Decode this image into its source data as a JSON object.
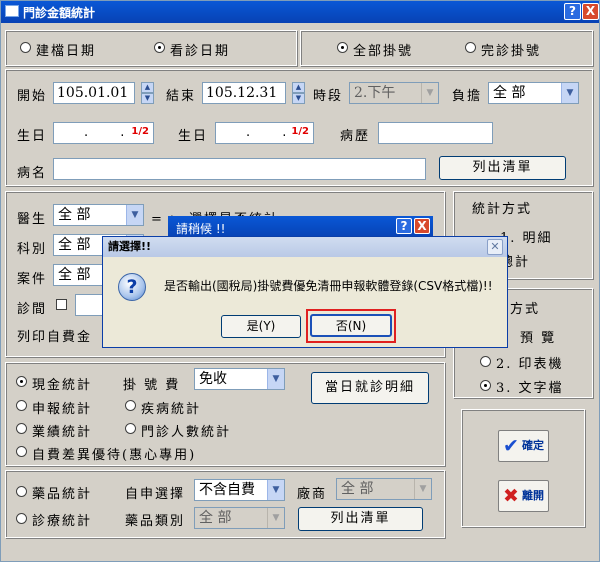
{
  "window": {
    "title": "門診金額統計",
    "help_btn": "?",
    "close_btn": "X"
  },
  "date_type": {
    "options": [
      "建檔日期",
      "看診日期"
    ],
    "selected": 1
  },
  "reg_type": {
    "options": [
      "全部掛號",
      "完診掛號"
    ],
    "selected": 0
  },
  "filters": {
    "start_label": "開始",
    "start_value": "105.01.01",
    "end_label": "結束",
    "end_value": "105.12.31",
    "period_label": "時段",
    "period_value": "2.下午",
    "burden_label": "負擔",
    "burden_value": "全 部",
    "birthday_label": "生日",
    "birthday_label2": "生日",
    "date_dots": ". .",
    "date_flag": "1/2",
    "history_label": "病歷",
    "name_label": "病名",
    "list_btn": "列出清單"
  },
  "mid": {
    "doctor_label": "醫生",
    "doctor_value": "全 部",
    "select_hint": "= > 選擇是否統計",
    "dept_label": "科別",
    "dept_value": "全 部",
    "case_label": "案件",
    "case_value": "全 部",
    "visit_label": "診間",
    "print_label": "列印自費金"
  },
  "stat_method": {
    "title": "統計方式",
    "items": [
      "1.  明細",
      "  總計"
    ]
  },
  "output_method": {
    "title": "方式",
    "items": [
      "預  覽",
      "2.  印表機",
      "3.  文字檔"
    ],
    "selected": 2
  },
  "stats": {
    "options": [
      "現金統計",
      "申報統計",
      "業績統計",
      "自費差異優待(惠心專用)"
    ],
    "selected": 0,
    "options2": [
      "疾病統計",
      "門診人數統計"
    ],
    "fee_label": "掛 號 費",
    "fee_value": "免收",
    "daily_btn": "當日就診明細"
  },
  "drug": {
    "options": [
      "藥品統計",
      "診療統計"
    ],
    "selfpay_label": "自申選擇",
    "selfpay_value": "不含自費",
    "vendor_label": "廠商",
    "vendor_value": "全 部",
    "category_label": "藥品類別",
    "category_value": "全 部",
    "list_btn": "列出清單"
  },
  "actions": {
    "confirm": "確定",
    "exit": "離開"
  },
  "waiting_dialog": {
    "title": "請稍候 !!"
  },
  "dialog": {
    "title": "請選擇!!",
    "message": "是否輸出(國稅局)掛號費優免清冊申報軟體登錄(CSV格式檔)!!",
    "yes": "是(Y)",
    "no": "否(N)"
  }
}
